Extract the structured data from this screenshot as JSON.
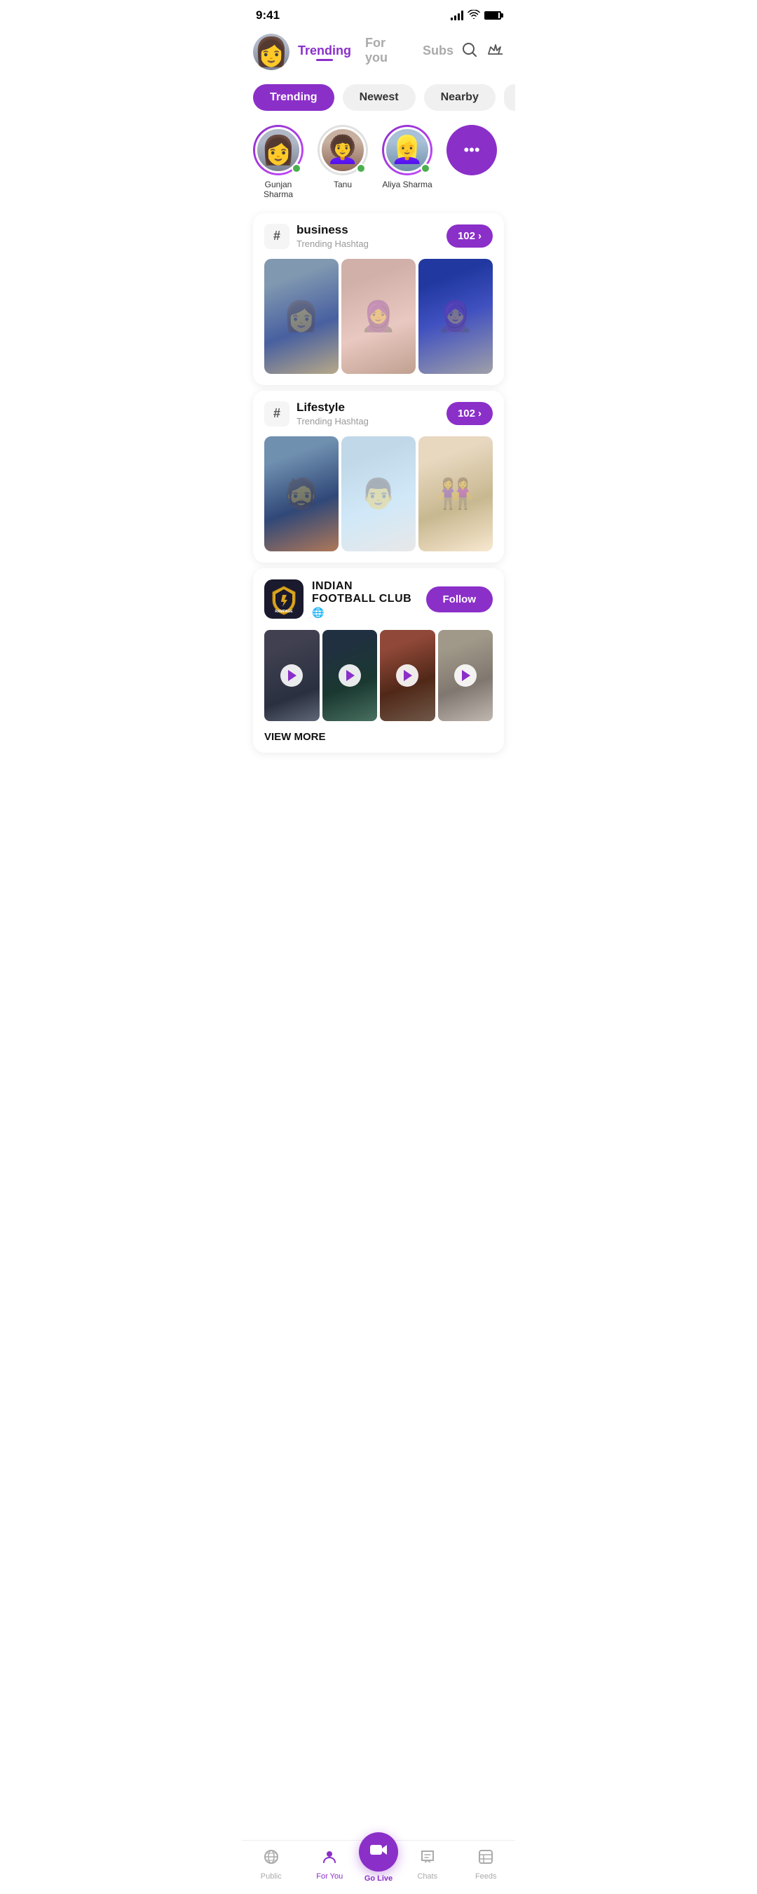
{
  "statusBar": {
    "time": "9:41"
  },
  "header": {
    "tabs": [
      {
        "id": "trending",
        "label": "Trending",
        "active": true
      },
      {
        "id": "for-you",
        "label": "For you",
        "active": false
      },
      {
        "id": "subs",
        "label": "Subs",
        "active": false
      }
    ]
  },
  "filterTabs": [
    {
      "id": "trending",
      "label": "Trending",
      "active": true
    },
    {
      "id": "newest",
      "label": "Newest",
      "active": false
    },
    {
      "id": "nearby",
      "label": "Nearby",
      "active": false
    }
  ],
  "stories": [
    {
      "name": "Gunjan Sharma",
      "online": true
    },
    {
      "name": "Tanu",
      "online": true
    },
    {
      "name": "Aliya Sharma",
      "online": true
    }
  ],
  "hashtagCards": [
    {
      "id": "business",
      "hashtag": "business",
      "subtitle": "Trending Hashtag",
      "count": "102"
    },
    {
      "id": "lifestyle",
      "hashtag": "Lifestyle",
      "subtitle": "Trending Hashtag",
      "count": "102"
    }
  ],
  "clubCard": {
    "name": "INDIAN FOOTBALL CLUB",
    "logoText": "WINDY city",
    "globalIcon": "🌐",
    "followLabel": "Follow",
    "viewMoreLabel": "VIEW MORE"
  },
  "bottomNav": {
    "items": [
      {
        "id": "public",
        "label": "Public",
        "active": false,
        "icon": "📡"
      },
      {
        "id": "for-you",
        "label": "For You",
        "active": true,
        "icon": "👤"
      },
      {
        "id": "go-live",
        "label": "Go Live",
        "active": false,
        "icon": "🎥"
      },
      {
        "id": "chats",
        "label": "Chats",
        "active": false,
        "icon": "💬"
      },
      {
        "id": "feeds",
        "label": "Feeds",
        "active": false,
        "icon": "📋"
      }
    ]
  }
}
